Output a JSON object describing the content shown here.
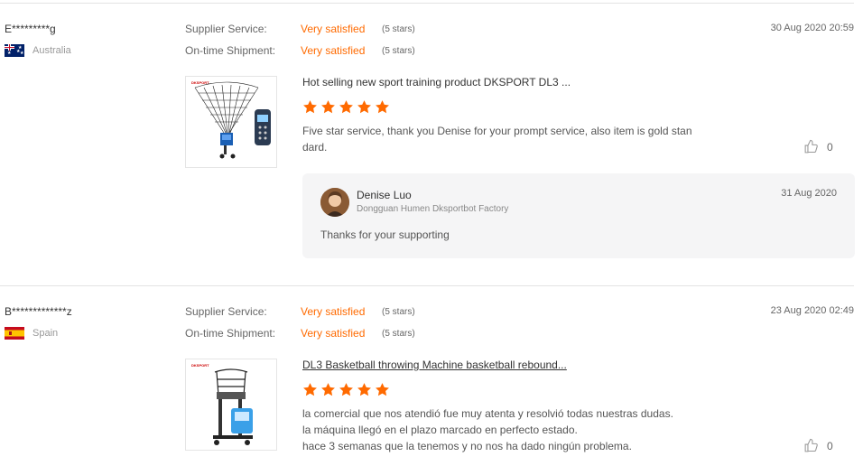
{
  "colors": {
    "accent": "#ff6a00",
    "divider": "#e3e3e3",
    "reply_bg": "#f5f5f6"
  },
  "reviews": [
    {
      "buyer": "E*********g",
      "country": "Australia",
      "flag": "australia-flag-icon",
      "supplier_label": "Supplier Service:",
      "supplier_value": "Very satisfied",
      "supplier_stars": "(5 stars)",
      "shipment_label": "On-time Shipment:",
      "shipment_value": "Very satisfied",
      "shipment_stars": "(5 stars)",
      "date": "30 Aug 2020 20:59",
      "product_title": "Hot selling new sport training product DKSPORT DL3 ...",
      "rating": 5,
      "comment_lines": [
        "Five star service, thank you Denise for your prompt service, also item is gold stan",
        "dard."
      ],
      "likes": "0",
      "reply": {
        "name": "Denise Luo",
        "company": "Dongguan Humen Dksportbot Factory",
        "date": "31 Aug 2020",
        "text": "Thanks for your supporting"
      }
    },
    {
      "buyer": "B*************z",
      "country": "Spain",
      "flag": "spain-flag-icon",
      "supplier_label": "Supplier Service:",
      "supplier_value": "Very satisfied",
      "supplier_stars": "(5 stars)",
      "shipment_label": "On-time Shipment:",
      "shipment_value": "Very satisfied",
      "shipment_stars": "(5 stars)",
      "date": "23 Aug 2020 02:49",
      "product_title": "DL3 Basketball throwing Machine basketball rebound...",
      "rating": 5,
      "comment_lines": [
        "la comercial que nos atendió fue muy atenta y resolvió todas nuestras dudas.",
        "la máquina llegó en el plazo marcado en perfecto estado.",
        "hace 3 semanas que la tenemos y no nos ha dado ningún problema."
      ],
      "likes": "0"
    }
  ]
}
